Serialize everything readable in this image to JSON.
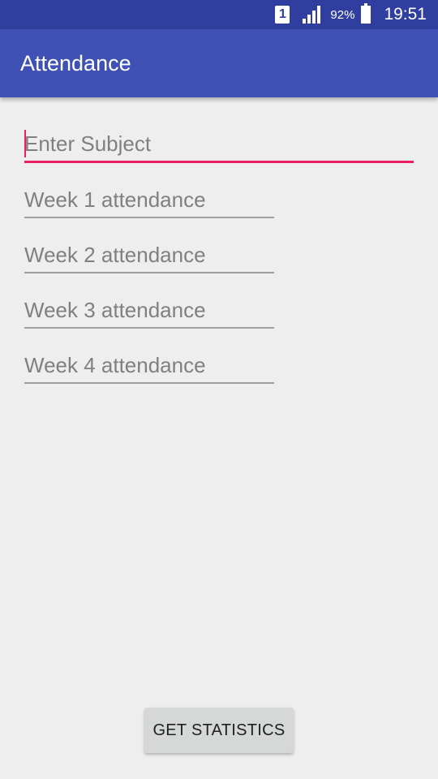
{
  "status_bar": {
    "sim_label": "1",
    "battery_percent": "92%",
    "time": "19:51"
  },
  "app_bar": {
    "title": "Attendance"
  },
  "form": {
    "subject_placeholder": "Enter Subject",
    "week1_placeholder": "Week 1 attendance",
    "week2_placeholder": "Week 2 attendance",
    "week3_placeholder": "Week 3 attendance",
    "week4_placeholder": "Week 4 attendance"
  },
  "actions": {
    "get_statistics_label": "GET STATISTICS"
  },
  "colors": {
    "status_bar": "#303f9f",
    "app_bar": "#3f51b5",
    "accent": "#e91e63",
    "background": "#eeeeee"
  }
}
